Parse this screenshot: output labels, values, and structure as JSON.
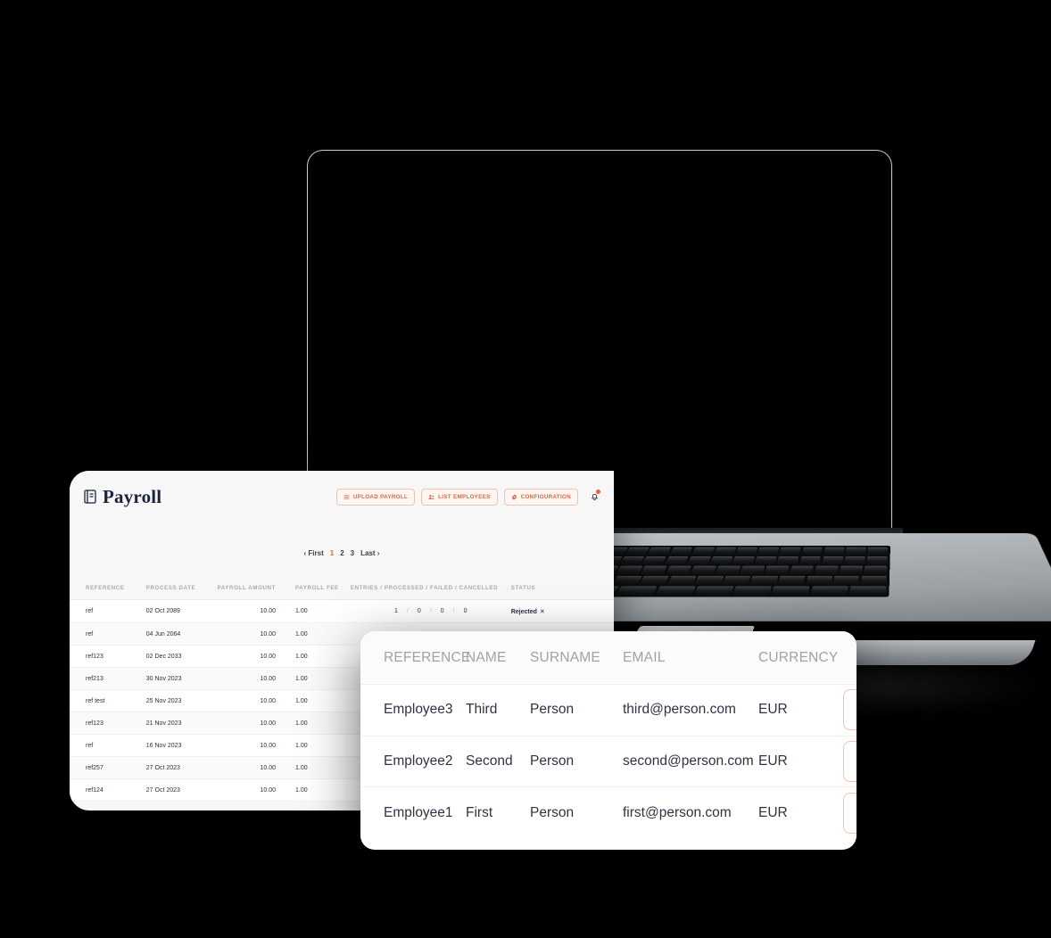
{
  "app": {
    "brand_title": "Payroll",
    "brand_icon": "book-icon"
  },
  "header": {
    "buttons": [
      {
        "label": "UPLOAD PAYROLL",
        "icon": "list-icon"
      },
      {
        "label": "LIST EMPLOYEES",
        "icon": "people-icon"
      },
      {
        "label": "CONFIGURATION",
        "icon": "gear-icon"
      }
    ],
    "notification_icon": "bell-icon",
    "notification_dot_color": "#e8682c"
  },
  "pagination": {
    "first_label": "‹ First",
    "pages": [
      "1",
      "2",
      "3"
    ],
    "active_page": "1",
    "last_label": "Last ›"
  },
  "payroll_table": {
    "columns": [
      "REFERENCE",
      "PROCESS DATE",
      "PAYROLL AMOUNT",
      "PAYROLL FEE",
      "ENTRIES / PROCESSED / FAILED / CANCELLED",
      "STATUS"
    ],
    "rows": [
      {
        "reference": "ref",
        "process_date": "02 Oct 2089",
        "amount": "10.00",
        "fee": "1.00",
        "entries": "1",
        "processed": "0",
        "failed": "0",
        "cancelled": "0",
        "status": "Rejected",
        "status_icon": "✕"
      },
      {
        "reference": "ref",
        "process_date": "04 Jun 2064",
        "amount": "10.00",
        "fee": "1.00",
        "entries": "",
        "processed": "",
        "failed": "",
        "cancelled": "",
        "status": "",
        "status_icon": ""
      },
      {
        "reference": "ref123",
        "process_date": "02 Dec 2033",
        "amount": "10.00",
        "fee": "1.00",
        "entries": "",
        "processed": "",
        "failed": "",
        "cancelled": "",
        "status": "",
        "status_icon": ""
      },
      {
        "reference": "ref213",
        "process_date": "30 Nov 2023",
        "amount": "10.00",
        "fee": "1.00",
        "entries": "",
        "processed": "",
        "failed": "",
        "cancelled": "",
        "status": "",
        "status_icon": ""
      },
      {
        "reference": "ref test",
        "process_date": "25 Nov 2023",
        "amount": "10.00",
        "fee": "1.00",
        "entries": "",
        "processed": "",
        "failed": "",
        "cancelled": "",
        "status": "",
        "status_icon": ""
      },
      {
        "reference": "ref123",
        "process_date": "21 Nov 2023",
        "amount": "10.00",
        "fee": "1.00",
        "entries": "",
        "processed": "",
        "failed": "",
        "cancelled": "",
        "status": "",
        "status_icon": ""
      },
      {
        "reference": "ref",
        "process_date": "16 Nov 2023",
        "amount": "10.00",
        "fee": "1.00",
        "entries": "",
        "processed": "",
        "failed": "",
        "cancelled": "",
        "status": "",
        "status_icon": ""
      },
      {
        "reference": "ref257",
        "process_date": "27 Oct 2023",
        "amount": "10.00",
        "fee": "1.00",
        "entries": "",
        "processed": "",
        "failed": "",
        "cancelled": "",
        "status": "",
        "status_icon": ""
      },
      {
        "reference": "ref124",
        "process_date": "27 Oct 2023",
        "amount": "10.00",
        "fee": "1.00",
        "entries": "",
        "processed": "",
        "failed": "",
        "cancelled": "",
        "status": "",
        "status_icon": ""
      }
    ]
  },
  "employee_card": {
    "columns": [
      "REFERENCE",
      "NAME",
      "SURNAME",
      "EMAIL",
      "CURRENCY"
    ],
    "delete_icon": "trash-icon",
    "rows": [
      {
        "reference": "Employee3",
        "name": "Third",
        "surname": "Person",
        "email": "third@person.com",
        "currency": "EUR"
      },
      {
        "reference": "Employee2",
        "name": "Second",
        "surname": "Person",
        "email": "second@person.com",
        "currency": "EUR"
      },
      {
        "reference": "Employee1",
        "name": "First",
        "surname": "Person",
        "email": "first@person.com",
        "currency": "EUR"
      }
    ]
  },
  "theme": {
    "accent": "#e8682c",
    "accent_border": "#f0c3ae",
    "brand_navy": "#1c2340",
    "background": "#000000"
  }
}
